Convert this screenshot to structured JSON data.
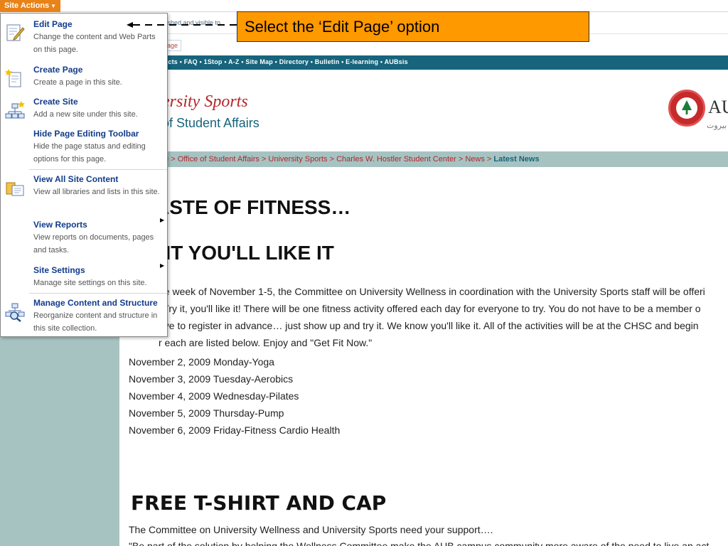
{
  "site_actions": {
    "label": "Site Actions"
  },
  "status": {
    "text": "...shed and visible to"
  },
  "page_chip": "age",
  "nav": {
    "text": "tacts • FAQ • 1Stop • A-Z • Site Map • Directory • Bulletin • E-learning • AUBsis"
  },
  "banner": {
    "title": "ersity Sports",
    "subtitle": "of Student Affairs"
  },
  "logo": {
    "text": "AU",
    "subtitle": "بيروت"
  },
  "breadcrumb": {
    "path": "te > Office of Student Affairs > University Sports > Charles W. Hostler Student Center > News > ",
    "current": "Latest News"
  },
  "article": {
    "heading1": "ASTE OF FITNESS…",
    "heading2": "' IT YOU'LL LIKE IT",
    "paragraph_lines": [
      "he week of November 1-5, the Committee on University Wellness in coordination with the University Sports staff will be offeri",
      "' Try it, you'll like it!  There will be one fitness activity offered each day for everyone to try.  You do not have to be a member o",
      "ave to register in advance… just show up and try it.  We know you'll like it.   All of the activities will be at the CHSC and begin",
      "r each are listed below. Enjoy and \"Get Fit Now.\""
    ],
    "schedule": [
      "November 2, 2009 Monday-Yoga",
      "November 3, 2009  Tuesday-Aerobics",
      "November 4, 2009 Wednesday-Pilates",
      "November 5, 2009  Thursday-Pump",
      "November 6, 2009  Friday-Fitness Cardio Health"
    ],
    "heading3": "FREE T-SHIRT AND CAP",
    "footer_line1": "The Committee on University Wellness and University Sports need your support….",
    "footer_line2": "\"Be part of the solution by helping the Wellness Committee make the AUB campus community more aware of the need to live an act"
  },
  "menu": {
    "items": [
      {
        "title": "Edit Page",
        "desc": "Change the content and Web Parts on this page.",
        "icon": "edit-page-icon"
      },
      {
        "title": "Create Page",
        "desc": "Create a page in this site.",
        "icon": "create-page-icon"
      },
      {
        "title": "Create Site",
        "desc": "Add a new site under this site.",
        "icon": "create-site-icon"
      },
      {
        "title": "Hide Page Editing Toolbar",
        "desc": "Hide the page status and editing options for this page.",
        "icon": ""
      },
      {
        "title": "View All Site Content",
        "desc": "View all libraries and lists in this site.",
        "icon": "site-content-icon"
      },
      {
        "title": "View Reports",
        "desc": "View reports on documents, pages and tasks.",
        "icon": ""
      },
      {
        "title": "Site Settings",
        "desc": "Manage site settings on this site.",
        "icon": ""
      },
      {
        "title": "Manage Content and Structure",
        "desc": "Reorganize content and structure in this site collection.",
        "icon": "manage-content-icon"
      }
    ]
  },
  "callout": {
    "text": "Select the ‘Edit Page’ option"
  },
  "colors": {
    "accent": "#e98217",
    "nav": "#17647c",
    "sidebar": "#a6c3c2",
    "callout": "#ff9900",
    "brand_red": "#b5262b"
  }
}
